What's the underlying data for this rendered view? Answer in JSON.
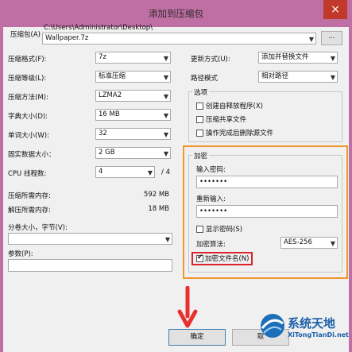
{
  "window": {
    "title": "添加到压缩包",
    "close": "×"
  },
  "archive": {
    "label": "压缩包(A)",
    "path": "C:\\Users\\Administrator\\Desktop\\",
    "filename": "Wallpaper.7z",
    "browse_label": "..."
  },
  "left": {
    "format": {
      "label": "压缩格式(F):",
      "value": "7z"
    },
    "level": {
      "label": "压缩等级(L):",
      "value": "标准压缩"
    },
    "method": {
      "label": "压缩方法(M):",
      "value": "LZMA2"
    },
    "dict": {
      "label": "字典大小(D):",
      "value": "16 MB"
    },
    "word": {
      "label": "单词大小(W):",
      "value": "32"
    },
    "solid": {
      "label": "固实数据大小：",
      "value": "2 GB"
    },
    "threads": {
      "label": "CPU 线程数:",
      "value": "4",
      "total": "/ 4"
    },
    "mem_compress": {
      "label": "压缩所需内存:",
      "value": "592 MB"
    },
    "mem_decompress": {
      "label": "解压所需内存:",
      "value": "18 MB"
    },
    "split": {
      "label": "分卷大小，字节(V):",
      "value": ""
    },
    "params": {
      "label": "参数(P):",
      "value": ""
    }
  },
  "right": {
    "update_mode": {
      "label": "更新方式(U):",
      "value": "添加并替换文件"
    },
    "path_mode": {
      "label": "路径模式",
      "value": "相对路径"
    },
    "options": {
      "title": "选项",
      "sfx": {
        "label": "创建自释放程序(X)",
        "checked": false
      },
      "shared": {
        "label": "压缩共享文件",
        "checked": false
      },
      "delete_after": {
        "label": "操作完成后删除源文件",
        "checked": false
      }
    },
    "encryption": {
      "title": "加密",
      "password_label": "输入密码:",
      "password_value": "•••••••",
      "reenter_label": "重新输入:",
      "reenter_value": "•••••••",
      "show_password": {
        "label": "显示密码(S)",
        "checked": false
      },
      "method_label": "加密算法:",
      "method_value": "AES-256",
      "encrypt_names": {
        "label": "加密文件名(N)",
        "checked": true
      }
    }
  },
  "buttons": {
    "ok": "确定",
    "cancel": "取"
  },
  "watermark": {
    "text": "系统天地",
    "url": "XiTongTianDi.net"
  },
  "colors": {
    "titlebar": "#c06fa4",
    "highlight_orange": "#f0962f",
    "highlight_red": "#d9232d",
    "arrow_red": "#e8312f"
  }
}
